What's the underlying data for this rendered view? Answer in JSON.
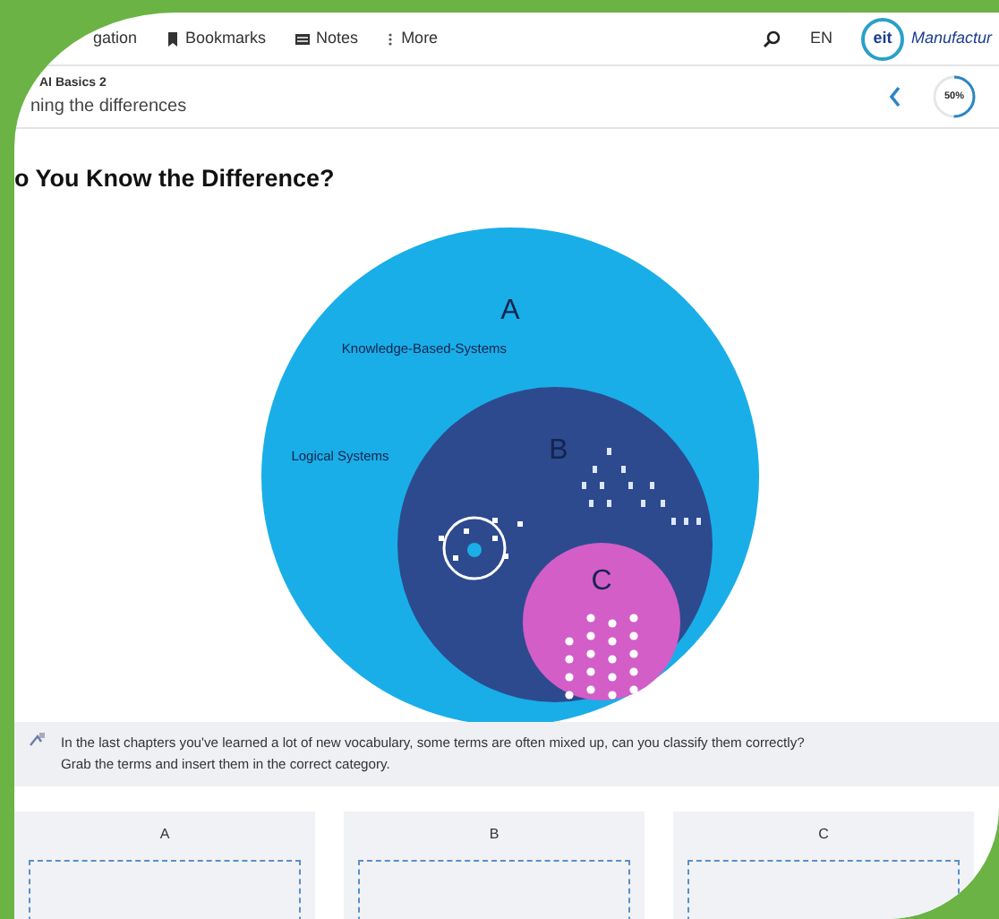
{
  "nav": {
    "items": [
      {
        "kind": "text",
        "label": "gation"
      },
      {
        "kind": "bookmark",
        "label": "Bookmarks"
      },
      {
        "kind": "notes",
        "label": "Notes"
      },
      {
        "kind": "more",
        "label": "More"
      }
    ],
    "language": "EN",
    "logo": {
      "mark": "eit",
      "name": "Manufactur"
    }
  },
  "breadcrumb": {
    "course": "AI Basics 2",
    "lesson": "ning the differences"
  },
  "progress": {
    "level": 0.5,
    "reading": "50%"
  },
  "heading": "o You Know the Difference?",
  "venn": {
    "labels": [
      {
        "kind": "letter",
        "text": "A"
      },
      {
        "kind": "term",
        "text": "Knowledge-Based-Systems"
      },
      {
        "kind": "term",
        "text": "Logical Systems"
      },
      {
        "kind": "letter",
        "text": "B"
      },
      {
        "kind": "letter",
        "text": "C"
      }
    ]
  },
  "instruction": [
    "In the last chapters you've learned a lot of new vocabulary, some terms are often mixed up, can you classify them correctly?",
    "Grab the terms and insert them in the correct category."
  ],
  "categories": [
    {
      "title": "A"
    },
    {
      "title": "B"
    },
    {
      "title": "C"
    }
  ]
}
